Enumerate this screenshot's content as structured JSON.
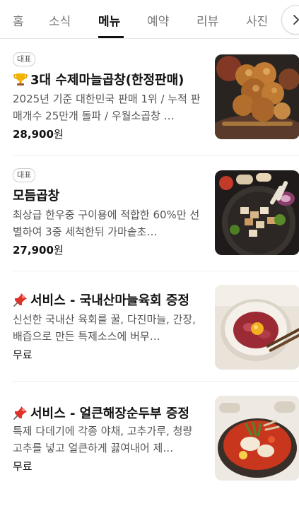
{
  "tabs": [
    {
      "label": "홈",
      "active": false
    },
    {
      "label": "소식",
      "active": false
    },
    {
      "label": "메뉴",
      "active": true
    },
    {
      "label": "예약",
      "active": false
    },
    {
      "label": "리뷰",
      "active": false
    },
    {
      "label": "사진",
      "active": false
    }
  ],
  "tabs_next_icon": "chevron-right-icon",
  "menu": {
    "items": [
      {
        "badge": "대표",
        "icon": "trophy-icon",
        "name": "3대 수제마늘곱창(한정판매)",
        "description": "2025년 기준 대한민국 판매 1위 / 누적 판매개수 25만개 돌파 / 우월소곱창 …",
        "price_amount": "28,900",
        "price_unit": "원",
        "image": "garlic-gopchang-photo"
      },
      {
        "badge": "대표",
        "icon": "",
        "name": "모듬곱창",
        "description": "최상급 한우중 구이용에 적합한 60%만 선별하여 3중 세척한뒤 가마솥초…",
        "price_amount": "27,900",
        "price_unit": "원",
        "image": "assorted-gopchang-photo"
      },
      {
        "badge": "",
        "icon": "pushpin-icon",
        "name": "서비스 - 국내산마늘육회 증정",
        "description": "신선한 국내산 육회를 꿀, 다진마늘, 간장, 배즙으로 만든 특제소스에 버무…",
        "price_text": "무료",
        "image": "yukhoe-photo"
      },
      {
        "badge": "",
        "icon": "pushpin-icon",
        "name": "서비스 - 얼큰해장순두부 증정",
        "description": "특제 다데기에 각종 야채, 고추가루, 청량고추를 넣고 얼큰하게 끓여내어 제…",
        "price_text": "무료",
        "image": "sundubu-stew-photo"
      }
    ]
  }
}
